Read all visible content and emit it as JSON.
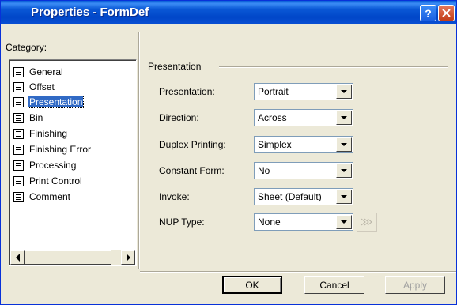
{
  "window": {
    "title": "Properties - FormDef",
    "help_glyph": "?"
  },
  "category": {
    "label": "Category:",
    "items": [
      {
        "label": "General"
      },
      {
        "label": "Offset"
      },
      {
        "label": "Presentation",
        "selected": true
      },
      {
        "label": "Bin"
      },
      {
        "label": "Finishing"
      },
      {
        "label": "Finishing Error"
      },
      {
        "label": "Processing"
      },
      {
        "label": "Print Control"
      },
      {
        "label": "Comment"
      }
    ]
  },
  "group": {
    "title": "Presentation"
  },
  "fields": [
    {
      "label": "Presentation:",
      "value": "Portrait"
    },
    {
      "label": "Direction:",
      "value": "Across"
    },
    {
      "label": "Duplex Printing:",
      "value": "Simplex"
    },
    {
      "label": "Constant Form:",
      "value": "No"
    },
    {
      "label": "Invoke:",
      "value": "Sheet (Default)"
    },
    {
      "label": "NUP Type:",
      "value": "None"
    }
  ],
  "buttons": {
    "ok": "OK",
    "cancel": "Cancel",
    "apply": "Apply"
  },
  "colors": {
    "titlebar": "#0a58d6",
    "selection": "#316ac5",
    "dialog_bg": "#ece9d8"
  }
}
